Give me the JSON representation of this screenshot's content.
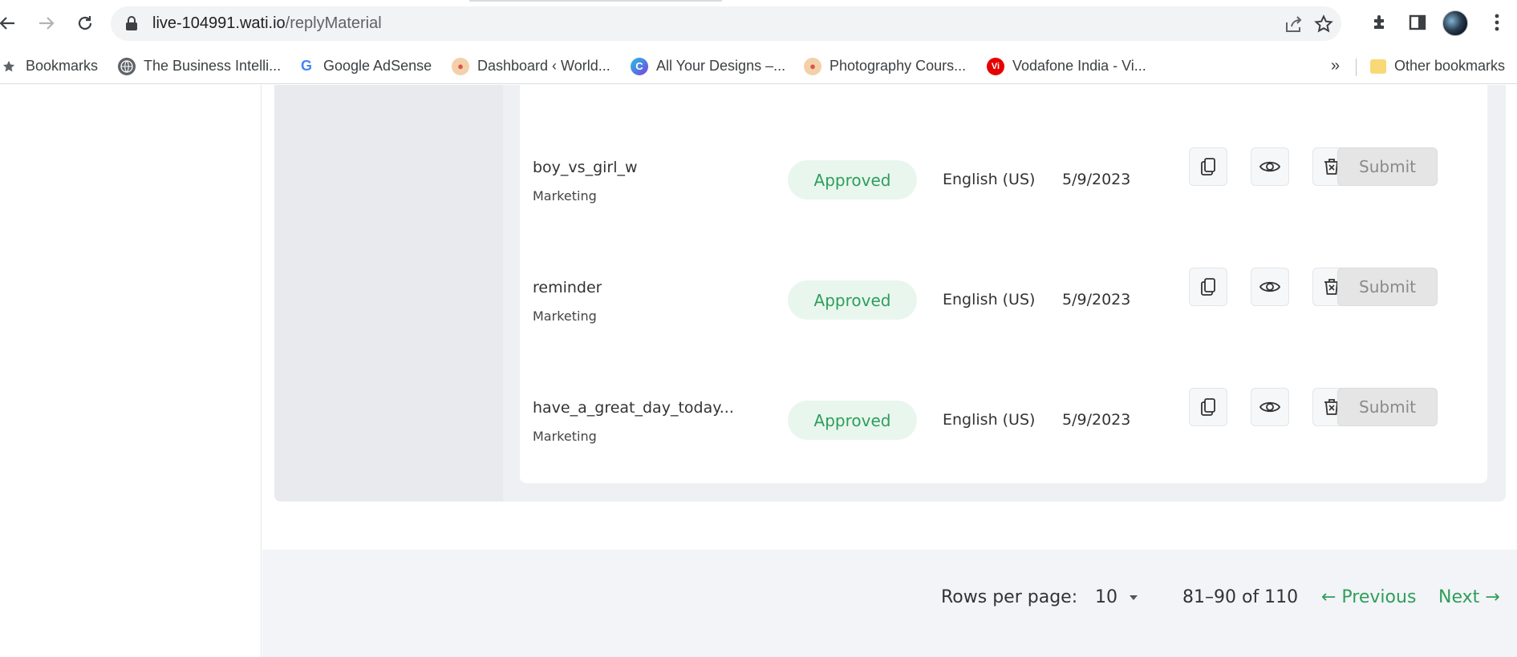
{
  "browser": {
    "url_host": "live-104991.wati.io",
    "url_path": "/replyMaterial",
    "bookmarks": [
      {
        "label": "Bookmarks",
        "icon": "star-icon"
      },
      {
        "label": "The Business Intelli...",
        "icon": "globe-icon"
      },
      {
        "label": "Google AdSense",
        "icon": "google-icon"
      },
      {
        "label": "Dashboard ‹ World...",
        "icon": "site-icon"
      },
      {
        "label": "All Your Designs –...",
        "icon": "canva-icon"
      },
      {
        "label": "Photography Cours...",
        "icon": "site-icon"
      },
      {
        "label": "Vodafone India - Vi...",
        "icon": "vodafone-icon"
      }
    ],
    "overflow_label": "»",
    "other_bookmarks": "Other bookmarks"
  },
  "colors": {
    "accent_green": "#2e9e5b",
    "status_bg": "#e9f6ee",
    "submit_disabled_bg": "#e5e5e5"
  },
  "templates": [
    {
      "name": "boy_vs_girl_w",
      "category": "Marketing",
      "status": "Approved",
      "language": "English (US)",
      "date": "5/9/2023",
      "submit_label": "Submit"
    },
    {
      "name": "reminder",
      "category": "Marketing",
      "status": "Approved",
      "language": "English (US)",
      "date": "5/9/2023",
      "submit_label": "Submit"
    },
    {
      "name": "have_a_great_day_today...",
      "category": "Marketing",
      "status": "Approved",
      "language": "English (US)",
      "date": "5/9/2023",
      "submit_label": "Submit"
    }
  ],
  "pagination": {
    "rows_label": "Rows per page:",
    "rows_value": "10",
    "range": "81–90 of 110",
    "previous": "← Previous",
    "next": "Next →"
  }
}
